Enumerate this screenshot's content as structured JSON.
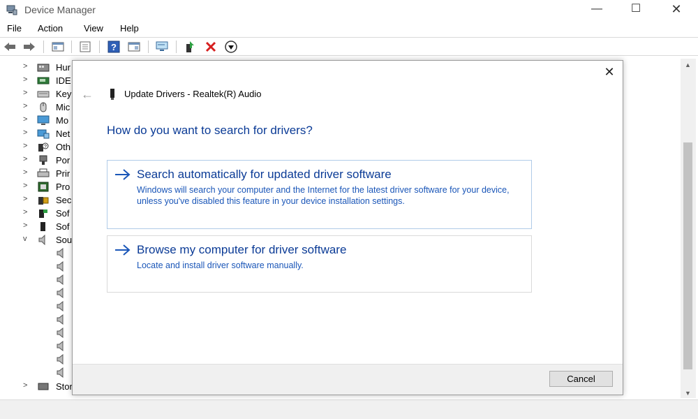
{
  "window": {
    "title": "Device Manager",
    "controls": {
      "minimize": "—",
      "maximize": "☐",
      "close": "✕"
    }
  },
  "menu": [
    "File",
    "Action",
    "View",
    "Help"
  ],
  "toolbar": {
    "icons": [
      "back-icon",
      "forward-icon",
      "show-hide-console-tree-icon",
      "properties-icon",
      "help-icon",
      "action-pane-icon",
      "scan-hardware-icon",
      "update-driver-icon",
      "uninstall-icon",
      "disable-device-icon"
    ]
  },
  "tree": {
    "categories": [
      {
        "label": "Hur",
        "expanded": false,
        "icon": "hid-icon"
      },
      {
        "label": "IDE",
        "expanded": false,
        "icon": "ide-controller-icon"
      },
      {
        "label": "Key",
        "expanded": false,
        "icon": "keyboard-icon"
      },
      {
        "label": "Mic",
        "expanded": false,
        "icon": "mouse-icon"
      },
      {
        "label": "Mo",
        "expanded": false,
        "icon": "monitor-icon"
      },
      {
        "label": "Net",
        "expanded": false,
        "icon": "network-adapter-icon"
      },
      {
        "label": "Oth",
        "expanded": false,
        "icon": "other-devices-icon"
      },
      {
        "label": "Por",
        "expanded": false,
        "icon": "ports-icon"
      },
      {
        "label": "Prir",
        "expanded": false,
        "icon": "printer-icon"
      },
      {
        "label": "Pro",
        "expanded": false,
        "icon": "processor-icon"
      },
      {
        "label": "Sec",
        "expanded": false,
        "icon": "security-device-icon"
      },
      {
        "label": "Sof",
        "expanded": false,
        "icon": "software-component-icon"
      },
      {
        "label": "Sof",
        "expanded": false,
        "icon": "software-device-icon"
      },
      {
        "label": "Sou",
        "expanded": true,
        "icon": "sound-icon"
      }
    ],
    "sound_children_count": 10,
    "bottom_label": "Storage controllers",
    "chevron_collapsed": ">",
    "chevron_expanded": "v"
  },
  "dialog": {
    "close": "✕",
    "back": "←",
    "title": "Update Drivers - Realtek(R) Audio",
    "heading": "How do you want to search for drivers?",
    "options": [
      {
        "title": "Search automatically for updated driver software",
        "description": "Windows will search your computer and the Internet for the latest driver software for your device, unless you've disabled this feature in your device installation settings."
      },
      {
        "title": "Browse my computer for driver software",
        "description": "Locate and install driver software manually."
      }
    ],
    "cancel_label": "Cancel"
  },
  "colors": {
    "link_blue": "#0b3b96",
    "desc_blue": "#1a56b8",
    "option_border": "#c9d9ee",
    "footer_bg": "#f0f0f0"
  }
}
